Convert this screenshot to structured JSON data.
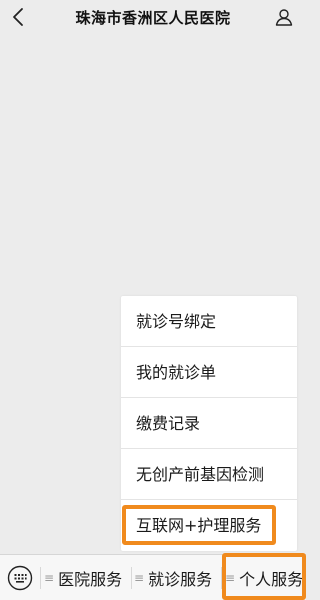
{
  "header": {
    "title": "珠海市香洲区人民医院",
    "back_icon": "chevron-left-icon",
    "user_icon": "user-icon"
  },
  "popup_menu": {
    "items": [
      {
        "label": "就诊号绑定"
      },
      {
        "label": "我的就诊单"
      },
      {
        "label": "缴费记录"
      },
      {
        "label": "无创产前基因检测"
      },
      {
        "label": "互联网+护理服务"
      }
    ]
  },
  "bottom_bar": {
    "keyboard_icon": "keyboard-icon",
    "tabs": [
      {
        "label": "医院服务",
        "glyph": "≡"
      },
      {
        "label": "就诊服务",
        "glyph": "≡"
      },
      {
        "label": "个人服务",
        "glyph": "≡"
      }
    ]
  },
  "colors": {
    "background": "#ececec",
    "highlight": "#f08a1d",
    "popup_bg": "#ffffff",
    "bar_bg": "#f7f7f7"
  }
}
